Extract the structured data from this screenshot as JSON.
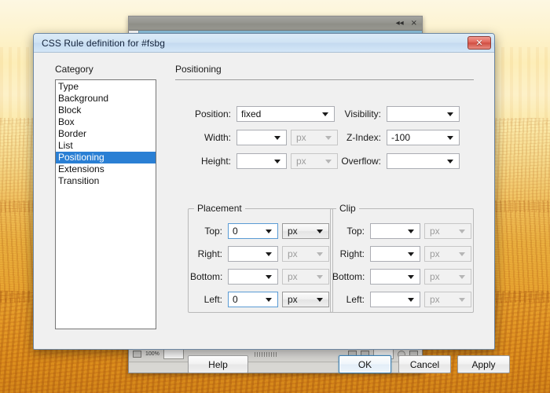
{
  "desktop": {
    "wallpaper_description": "orange-gold landscape photo",
    "sky_color": "#fdf3cf",
    "ground_color": "#e49a27"
  },
  "background_window": {
    "titlebar_icons": [
      {
        "name": "collapse-icon",
        "glyph": "◂◂"
      },
      {
        "name": "close-icon",
        "glyph": "×"
      }
    ],
    "toolbar": {
      "zoom_label": "100%",
      "field_value": ""
    }
  },
  "dialog": {
    "title": "CSS Rule definition for #fsbg",
    "close_label": "✕",
    "accent_color": "#2a7fd4",
    "category": {
      "heading": "Category",
      "items": [
        {
          "label": "Type",
          "selected": false
        },
        {
          "label": "Background",
          "selected": false
        },
        {
          "label": "Block",
          "selected": false
        },
        {
          "label": "Box",
          "selected": false
        },
        {
          "label": "Border",
          "selected": false
        },
        {
          "label": "List",
          "selected": false
        },
        {
          "label": "Positioning",
          "selected": true
        },
        {
          "label": "Extensions",
          "selected": false
        },
        {
          "label": "Transition",
          "selected": false
        }
      ]
    },
    "pane": {
      "heading": "Positioning",
      "left_fields": [
        {
          "label": "Position:",
          "value": "fixed",
          "unit": null,
          "unit_enabled": false,
          "focused": false
        },
        {
          "label": "Width:",
          "value": "",
          "unit": "px",
          "unit_enabled": false,
          "focused": false
        },
        {
          "label": "Height:",
          "value": "",
          "unit": "px",
          "unit_enabled": false,
          "focused": false
        }
      ],
      "right_fields": [
        {
          "label": "Visibility:",
          "value": ""
        },
        {
          "label": "Z-Index:",
          "value": "-100"
        },
        {
          "label": "Overflow:",
          "value": ""
        }
      ],
      "placement": {
        "legend": "Placement",
        "fields": [
          {
            "label": "Top:",
            "value": "0",
            "unit": "px",
            "unit_enabled": true,
            "focused": true
          },
          {
            "label": "Right:",
            "value": "",
            "unit": "px",
            "unit_enabled": false,
            "focused": false
          },
          {
            "label": "Bottom:",
            "value": "",
            "unit": "px",
            "unit_enabled": false,
            "focused": false
          },
          {
            "label": "Left:",
            "value": "0",
            "unit": "px",
            "unit_enabled": true,
            "focused": true
          }
        ]
      },
      "clip": {
        "legend": "Clip",
        "fields": [
          {
            "label": "Top:",
            "value": "",
            "unit": "px",
            "unit_enabled": false,
            "focused": false
          },
          {
            "label": "Right:",
            "value": "",
            "unit": "px",
            "unit_enabled": false,
            "focused": false
          },
          {
            "label": "Bottom:",
            "value": "",
            "unit": "px",
            "unit_enabled": false,
            "focused": false
          },
          {
            "label": "Left:",
            "value": "",
            "unit": "px",
            "unit_enabled": false,
            "focused": false
          }
        ]
      }
    },
    "buttons": {
      "help": "Help",
      "ok": "OK",
      "cancel": "Cancel",
      "apply": "Apply"
    }
  }
}
